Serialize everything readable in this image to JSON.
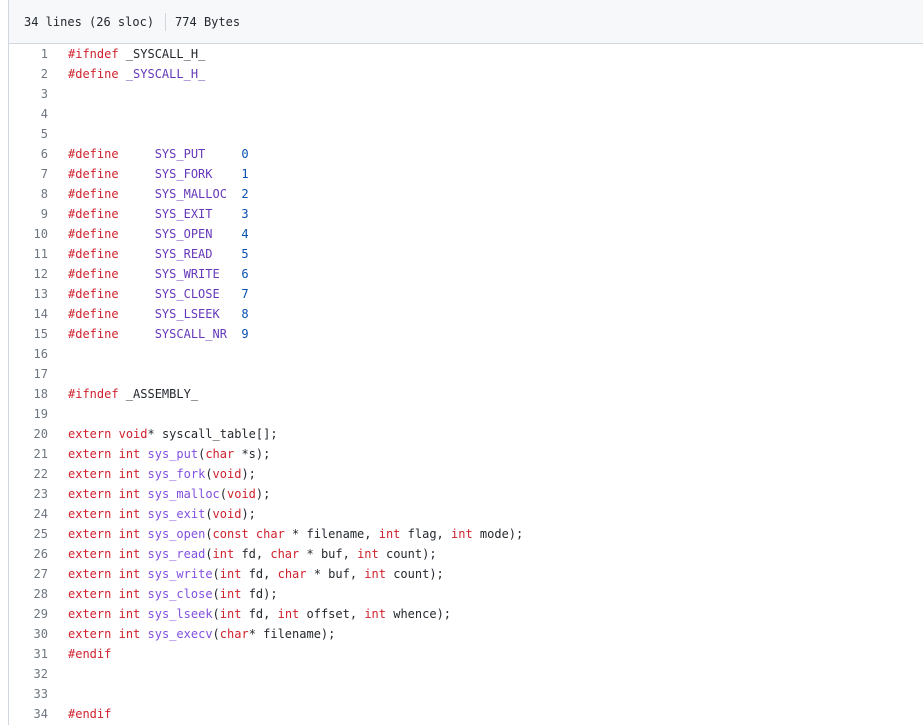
{
  "file_info": {
    "lines": "34 lines (26 sloc)",
    "size": "774 Bytes"
  },
  "lines": [
    {
      "n": "1",
      "tokens": [
        [
          "k",
          "#ifndef"
        ],
        [
          "",
          " _SYSCALL_H_"
        ]
      ]
    },
    {
      "n": "2",
      "tokens": [
        [
          "k",
          "#define"
        ],
        [
          "m",
          " _SYSCALL_H_"
        ]
      ]
    },
    {
      "n": "3",
      "tokens": []
    },
    {
      "n": "4",
      "tokens": []
    },
    {
      "n": "5",
      "tokens": []
    },
    {
      "n": "6",
      "tokens": [
        [
          "k",
          "#define"
        ],
        [
          "",
          "     "
        ],
        [
          "m",
          "SYS_PUT"
        ],
        [
          "",
          "     "
        ],
        [
          "n",
          "0"
        ]
      ]
    },
    {
      "n": "7",
      "tokens": [
        [
          "k",
          "#define"
        ],
        [
          "",
          "     "
        ],
        [
          "m",
          "SYS_FORK"
        ],
        [
          "",
          "    "
        ],
        [
          "n",
          "1"
        ]
      ]
    },
    {
      "n": "8",
      "tokens": [
        [
          "k",
          "#define"
        ],
        [
          "",
          "     "
        ],
        [
          "m",
          "SYS_MALLOC"
        ],
        [
          "",
          "  "
        ],
        [
          "n",
          "2"
        ]
      ]
    },
    {
      "n": "9",
      "tokens": [
        [
          "k",
          "#define"
        ],
        [
          "",
          "     "
        ],
        [
          "m",
          "SYS_EXIT"
        ],
        [
          "",
          "    "
        ],
        [
          "n",
          "3"
        ]
      ]
    },
    {
      "n": "10",
      "tokens": [
        [
          "k",
          "#define"
        ],
        [
          "",
          "     "
        ],
        [
          "m",
          "SYS_OPEN"
        ],
        [
          "",
          "    "
        ],
        [
          "n",
          "4"
        ]
      ]
    },
    {
      "n": "11",
      "tokens": [
        [
          "k",
          "#define"
        ],
        [
          "",
          "     "
        ],
        [
          "m",
          "SYS_READ"
        ],
        [
          "",
          "    "
        ],
        [
          "n",
          "5"
        ]
      ]
    },
    {
      "n": "12",
      "tokens": [
        [
          "k",
          "#define"
        ],
        [
          "",
          "     "
        ],
        [
          "m",
          "SYS_WRITE"
        ],
        [
          "",
          "   "
        ],
        [
          "n",
          "6"
        ]
      ]
    },
    {
      "n": "13",
      "tokens": [
        [
          "k",
          "#define"
        ],
        [
          "",
          "     "
        ],
        [
          "m",
          "SYS_CLOSE"
        ],
        [
          "",
          "   "
        ],
        [
          "n",
          "7"
        ]
      ]
    },
    {
      "n": "14",
      "tokens": [
        [
          "k",
          "#define"
        ],
        [
          "",
          "     "
        ],
        [
          "m",
          "SYS_LSEEK"
        ],
        [
          "",
          "   "
        ],
        [
          "n",
          "8"
        ]
      ]
    },
    {
      "n": "15",
      "tokens": [
        [
          "k",
          "#define"
        ],
        [
          "",
          "     "
        ],
        [
          "m",
          "SYSCALL_NR"
        ],
        [
          "",
          "  "
        ],
        [
          "n",
          "9"
        ]
      ]
    },
    {
      "n": "16",
      "tokens": []
    },
    {
      "n": "17",
      "tokens": []
    },
    {
      "n": "18",
      "tokens": [
        [
          "k",
          "#ifndef"
        ],
        [
          "",
          " _ASSEMBLY_"
        ]
      ]
    },
    {
      "n": "19",
      "tokens": []
    },
    {
      "n": "20",
      "tokens": [
        [
          "k",
          "extern"
        ],
        [
          "",
          " "
        ],
        [
          "k",
          "void"
        ],
        [
          "",
          "* syscall_table[];"
        ]
      ]
    },
    {
      "n": "21",
      "tokens": [
        [
          "k",
          "extern"
        ],
        [
          "",
          " "
        ],
        [
          "k",
          "int"
        ],
        [
          "",
          " "
        ],
        [
          "f",
          "sys_put"
        ],
        [
          "",
          "("
        ],
        [
          "k",
          "char"
        ],
        [
          "",
          " *s);"
        ]
      ]
    },
    {
      "n": "22",
      "tokens": [
        [
          "k",
          "extern"
        ],
        [
          "",
          " "
        ],
        [
          "k",
          "int"
        ],
        [
          "",
          " "
        ],
        [
          "f",
          "sys_fork"
        ],
        [
          "",
          "("
        ],
        [
          "k",
          "void"
        ],
        [
          "",
          ");"
        ]
      ]
    },
    {
      "n": "23",
      "tokens": [
        [
          "k",
          "extern"
        ],
        [
          "",
          " "
        ],
        [
          "k",
          "int"
        ],
        [
          "",
          " "
        ],
        [
          "f",
          "sys_malloc"
        ],
        [
          "",
          "("
        ],
        [
          "k",
          "void"
        ],
        [
          "",
          ");"
        ]
      ]
    },
    {
      "n": "24",
      "tokens": [
        [
          "k",
          "extern"
        ],
        [
          "",
          " "
        ],
        [
          "k",
          "int"
        ],
        [
          "",
          " "
        ],
        [
          "f",
          "sys_exit"
        ],
        [
          "",
          "("
        ],
        [
          "k",
          "void"
        ],
        [
          "",
          ");"
        ]
      ]
    },
    {
      "n": "25",
      "tokens": [
        [
          "k",
          "extern"
        ],
        [
          "",
          " "
        ],
        [
          "k",
          "int"
        ],
        [
          "",
          " "
        ],
        [
          "f",
          "sys_open"
        ],
        [
          "",
          "("
        ],
        [
          "k",
          "const"
        ],
        [
          "",
          " "
        ],
        [
          "k",
          "char"
        ],
        [
          "",
          " * filename, "
        ],
        [
          "k",
          "int"
        ],
        [
          "",
          " flag, "
        ],
        [
          "k",
          "int"
        ],
        [
          "",
          " mode);"
        ]
      ]
    },
    {
      "n": "26",
      "tokens": [
        [
          "k",
          "extern"
        ],
        [
          "",
          " "
        ],
        [
          "k",
          "int"
        ],
        [
          "",
          " "
        ],
        [
          "f",
          "sys_read"
        ],
        [
          "",
          "("
        ],
        [
          "k",
          "int"
        ],
        [
          "",
          " fd, "
        ],
        [
          "k",
          "char"
        ],
        [
          "",
          " * buf, "
        ],
        [
          "k",
          "int"
        ],
        [
          "",
          " count);"
        ]
      ]
    },
    {
      "n": "27",
      "tokens": [
        [
          "k",
          "extern"
        ],
        [
          "",
          " "
        ],
        [
          "k",
          "int"
        ],
        [
          "",
          " "
        ],
        [
          "f",
          "sys_write"
        ],
        [
          "",
          "("
        ],
        [
          "k",
          "int"
        ],
        [
          "",
          " fd, "
        ],
        [
          "k",
          "char"
        ],
        [
          "",
          " * buf, "
        ],
        [
          "k",
          "int"
        ],
        [
          "",
          " count);"
        ]
      ]
    },
    {
      "n": "28",
      "tokens": [
        [
          "k",
          "extern"
        ],
        [
          "",
          " "
        ],
        [
          "k",
          "int"
        ],
        [
          "",
          " "
        ],
        [
          "f",
          "sys_close"
        ],
        [
          "",
          "("
        ],
        [
          "k",
          "int"
        ],
        [
          "",
          " fd);"
        ]
      ]
    },
    {
      "n": "29",
      "tokens": [
        [
          "k",
          "extern"
        ],
        [
          "",
          " "
        ],
        [
          "k",
          "int"
        ],
        [
          "",
          " "
        ],
        [
          "f",
          "sys_lseek"
        ],
        [
          "",
          "("
        ],
        [
          "k",
          "int"
        ],
        [
          "",
          " fd, "
        ],
        [
          "k",
          "int"
        ],
        [
          "",
          " offset, "
        ],
        [
          "k",
          "int"
        ],
        [
          "",
          " whence);"
        ]
      ]
    },
    {
      "n": "30",
      "tokens": [
        [
          "k",
          "extern"
        ],
        [
          "",
          " "
        ],
        [
          "k",
          "int"
        ],
        [
          "",
          " "
        ],
        [
          "f",
          "sys_execv"
        ],
        [
          "",
          "("
        ],
        [
          "k",
          "char"
        ],
        [
          "",
          "* filename);"
        ]
      ]
    },
    {
      "n": "31",
      "tokens": [
        [
          "k",
          "#endif"
        ]
      ]
    },
    {
      "n": "32",
      "tokens": []
    },
    {
      "n": "33",
      "tokens": []
    },
    {
      "n": "34",
      "tokens": [
        [
          "k",
          "#endif"
        ]
      ]
    }
  ],
  "colors": {
    "keyword": "#cf222e",
    "number": "#0550ae",
    "function": "#8250df",
    "macro": "#6639ba",
    "line_number": "#6e7781",
    "header_bg": "#f6f8fa",
    "border": "#d0d7de"
  }
}
